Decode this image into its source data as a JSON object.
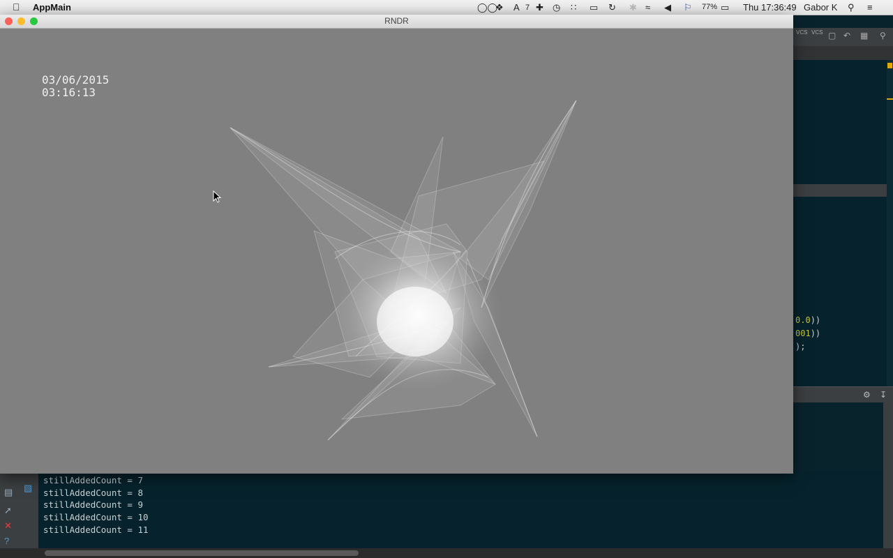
{
  "menubar": {
    "app_name": "AppMain",
    "notification_count": "7",
    "battery": "77%",
    "clock": "Thu 17:36:49",
    "user": "Gabor K"
  },
  "rndr_window": {
    "title": "RNDR",
    "date": "03/06/2015",
    "time": "03:16:13"
  },
  "ide": {
    "vcs_label_1": "VCS",
    "vcs_label_2": "VCS",
    "code_fragments": [
      {
        "prefix": "",
        "num": "0.0",
        "suffix": "))"
      },
      {
        "prefix": "",
        "num": "001",
        "suffix": "))"
      },
      {
        "prefix": ");",
        "num": "",
        "suffix": ""
      }
    ]
  },
  "console": {
    "lines": [
      "stillAddedCount = 7",
      "stillAddedCount = 8",
      "stillAddedCount = 9",
      "stillAddedCount = 10",
      "stillAddedCount = 11"
    ]
  },
  "colors": {
    "ide_bg": "#06232d",
    "render_bg": "#808080",
    "close": "#fc5f57",
    "minimize": "#fdbc2e",
    "zoom": "#28c840"
  },
  "icons": [
    "apple-icon",
    "glasses-icon",
    "dropbox-icon",
    "adobe-icon",
    "plus-icon",
    "clock-app-icon",
    "grid-icon",
    "airplay-icon",
    "time-machine-icon",
    "bluetooth-icon",
    "wifi-icon",
    "volume-icon",
    "flag-icon",
    "battery-icon",
    "search-icon",
    "list-icon"
  ]
}
